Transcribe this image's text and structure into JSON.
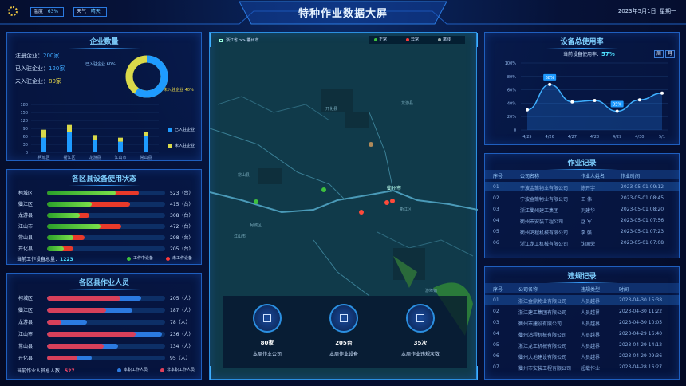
{
  "header": {
    "title": "特种作业数据大屏",
    "date": "2023年5月1日",
    "weekday": "星期一",
    "pill1_label": "温度",
    "pill1_value": "63%",
    "pill2_label": "天气",
    "pill2_value": "晴天"
  },
  "enterprise": {
    "title": "企业数量",
    "registered_label": "注册企业：",
    "registered_value": "200家",
    "joined_label": "已入驻企业：",
    "joined_value": "120家",
    "not_joined_label": "未入驻企业：",
    "not_joined_value": "80家",
    "donut_joined_label": "已入驻企业 60%",
    "donut_not_label": "未入驻企业 40%",
    "legend_joined": "已入驻企业",
    "legend_not": "未入驻企业",
    "colors": {
      "joined": "#1e9bff",
      "not": "#d9d94a"
    }
  },
  "chart_data": [
    {
      "type": "bar",
      "categories": [
        "柯城区",
        "衢江区",
        "龙游县",
        "江山市",
        "常山县"
      ],
      "series": [
        {
          "name": "已入驻企业",
          "values": [
            55,
            78,
            45,
            40,
            60
          ]
        },
        {
          "name": "未入驻企业",
          "values": [
            30,
            25,
            20,
            15,
            18
          ]
        }
      ],
      "yticks": [
        "180",
        "150",
        "120",
        "90",
        "60",
        "30",
        "0"
      ],
      "ylim": [
        0,
        180
      ]
    },
    {
      "type": "pie",
      "labels": [
        "已入驻企业",
        "未入驻企业"
      ],
      "values": [
        60,
        40
      ]
    },
    {
      "type": "line",
      "categories": [
        "4/25",
        "4/26",
        "4/27",
        "4/28",
        "4/29",
        "4/30",
        "5/1"
      ],
      "values": [
        30,
        68,
        42,
        44,
        28,
        45,
        55
      ],
      "yticks": [
        "100%",
        "80%",
        "60%",
        "40%",
        "20%",
        "0"
      ],
      "ylim": [
        0,
        100
      ],
      "callouts": [
        "68%",
        "35%"
      ]
    }
  ],
  "equipment": {
    "title": "各区县设备使用状态",
    "rows": [
      {
        "name": "柯城区",
        "value": "523（台）",
        "green": 0.58,
        "red": 0.2
      },
      {
        "name": "衢江区",
        "value": "415（台）",
        "green": 0.38,
        "red": 0.32
      },
      {
        "name": "龙游县",
        "value": "308（台）",
        "green": 0.28,
        "red": 0.08
      },
      {
        "name": "江山市",
        "value": "472（台）",
        "green": 0.45,
        "red": 0.18
      },
      {
        "name": "常山县",
        "value": "298（台）",
        "green": 0.22,
        "red": 0.1
      },
      {
        "name": "开化县",
        "value": "205（台）",
        "green": 0.14,
        "red": 0.08
      }
    ],
    "total_label": "当前工作设备总量：",
    "total_value": "1223",
    "legend_working": "工作中设备",
    "legend_idle": "未工作设备"
  },
  "personnel": {
    "title": "各区县作业人员",
    "rows": [
      {
        "name": "柯城区",
        "value": "205（人）",
        "red": 0.62,
        "blue": 0.18
      },
      {
        "name": "衢江区",
        "value": "187（人）",
        "red": 0.5,
        "blue": 0.22
      },
      {
        "name": "龙游县",
        "value": "78（人）",
        "red": 0.12,
        "blue": 0.22
      },
      {
        "name": "江山市",
        "value": "236（人）",
        "red": 0.75,
        "blue": 0.22
      },
      {
        "name": "常山县",
        "value": "134（人）",
        "red": 0.48,
        "blue": 0.12
      },
      {
        "name": "开化县",
        "value": "95（人）",
        "red": 0.26,
        "blue": 0.12
      }
    ],
    "total_label": "当前作业人员总人数：",
    "total_value": "527",
    "legend_work": "本职工作人员",
    "legend_nonwork": "非本职工作人员"
  },
  "map": {
    "breadcrumb": "浙江省 >> 衢州市",
    "legend": [
      "正常",
      "异常",
      "离线"
    ],
    "places": [
      "衢州市",
      "开化县",
      "江山市",
      "常山县",
      "龙游县",
      "柯城区",
      "衢江区",
      "游埠镇"
    ],
    "stats": [
      {
        "value": "80家",
        "label": "本周作业公司",
        "icon": "factory-icon"
      },
      {
        "value": "205台",
        "label": "本周作业设备",
        "icon": "crane-icon"
      },
      {
        "value": "35次",
        "label": "本周作业违规次数",
        "icon": "warning-icon"
      }
    ]
  },
  "usage": {
    "title": "设备总使用率",
    "current_label": "当前设备使用率：",
    "current_value": "57%",
    "btn_week": "周",
    "btn_month": "月"
  },
  "work_records": {
    "title": "作业记录",
    "headers": [
      "序号",
      "公司名称",
      "作业人姓名",
      "作业时间"
    ],
    "rows": [
      [
        "01",
        "宁波金策物业有限公司",
        "陈开宇",
        "2023-05-01 09:12"
      ],
      [
        "02",
        "宁波金策物业有限公司",
        "王 伟",
        "2023-05-01 08:45"
      ],
      [
        "03",
        "浙江衢州建工集团",
        "刘建华",
        "2023-05-01 08:20"
      ],
      [
        "04",
        "衢州市安装工程公司",
        "赵 军",
        "2023-05-01 07:56"
      ],
      [
        "05",
        "衢州鸿程机械有限公司",
        "李 强",
        "2023-05-01 07:23"
      ],
      [
        "06",
        "浙江龙工机械有限公司",
        "沈国荣",
        "2023-05-01 07:08"
      ]
    ]
  },
  "violation_records": {
    "title": "违规记录",
    "headers": [
      "序号",
      "公司名称",
      "违规类型",
      "时间"
    ],
    "rows": [
      [
        "01",
        "浙江金鼎物业有限公司",
        "人员越界",
        "2023-04-30 15:38"
      ],
      [
        "02",
        "浙江建工集团有限公司",
        "人员越界",
        "2023-04-30 11:22"
      ],
      [
        "03",
        "衢州市建设有限公司",
        "人员越界",
        "2023-04-30 10:05"
      ],
      [
        "04",
        "衢州鸿程机械有限公司",
        "人员越界",
        "2023-04-29 16:40"
      ],
      [
        "05",
        "浙江龙工机械有限公司",
        "人员越界",
        "2023-04-29 14:12"
      ],
      [
        "06",
        "衢州大地建设有限公司",
        "人员越界",
        "2023-04-29 09:36"
      ],
      [
        "07",
        "衢州市安装工程有限公司",
        "超载作业",
        "2023-04-28 16:27"
      ]
    ]
  }
}
